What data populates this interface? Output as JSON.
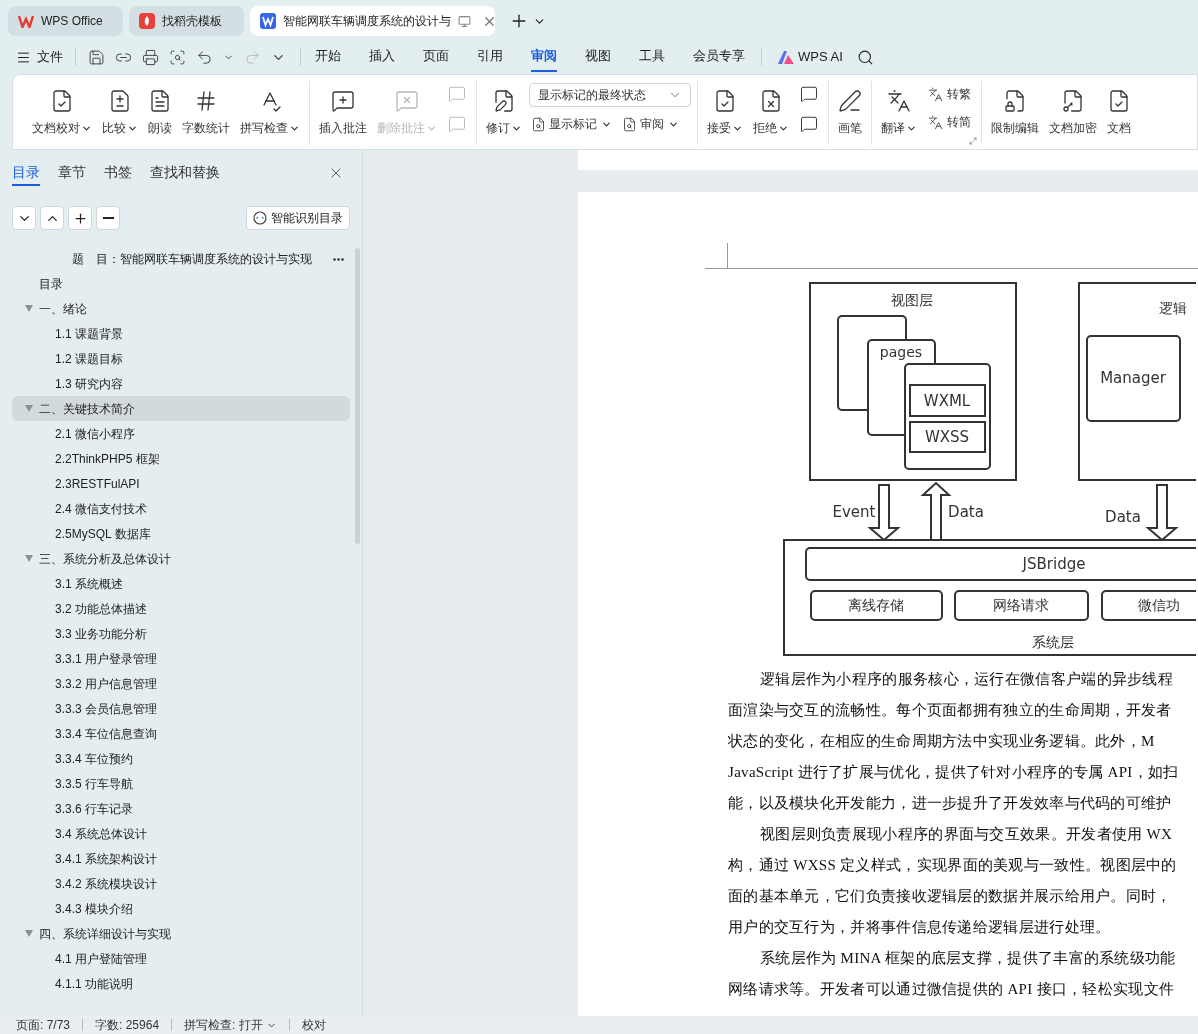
{
  "tabs": [
    {
      "label": "WPS Office",
      "selected": false,
      "kind": "home"
    },
    {
      "label": "找稻壳模板",
      "selected": false,
      "kind": "template"
    },
    {
      "label": "智能网联车辆调度系统的设计与",
      "selected": true,
      "kind": "doc"
    }
  ],
  "menu": {
    "file": "文件",
    "tabs": [
      {
        "label": "开始",
        "selected": false
      },
      {
        "label": "插入",
        "selected": false
      },
      {
        "label": "页面",
        "selected": false
      },
      {
        "label": "引用",
        "selected": false
      },
      {
        "label": "审阅",
        "selected": true
      },
      {
        "label": "视图",
        "selected": false
      },
      {
        "label": "工具",
        "selected": false
      },
      {
        "label": "会员专享",
        "selected": false
      }
    ],
    "ai": "WPS AI"
  },
  "ribbon": {
    "groups": [
      {
        "items": [
          {
            "kind": "large",
            "label": "文档校对",
            "caret": true,
            "disabled": false
          },
          {
            "kind": "large",
            "label": "比较",
            "caret": true,
            "disabled": false
          },
          {
            "kind": "large",
            "label": "朗读",
            "caret": false,
            "disabled": false
          },
          {
            "kind": "large",
            "label": "字数统计",
            "caret": false,
            "disabled": false
          },
          {
            "kind": "large",
            "label": "拼写检查",
            "caret": true,
            "disabled": false
          }
        ]
      },
      {
        "items": [
          {
            "kind": "large",
            "label": "插入批注",
            "caret": false,
            "disabled": false
          },
          {
            "kind": "large",
            "label": "删除批注",
            "caret": true,
            "disabled": true
          },
          {
            "kind": "icons",
            "disabled": true
          }
        ]
      },
      {
        "items": [
          {
            "kind": "large",
            "label": "修订",
            "caret": true,
            "disabled": false
          },
          {
            "kind": "panel",
            "select": "显示标记的最终状态",
            "buttons": [
              {
                "label": "显示标记",
                "caret": true
              },
              {
                "label": "审阅",
                "caret": true
              }
            ]
          }
        ]
      },
      {
        "items": [
          {
            "kind": "large",
            "label": "接受",
            "caret": true,
            "disabled": false
          },
          {
            "kind": "large",
            "label": "拒绝",
            "caret": true,
            "disabled": false
          },
          {
            "kind": "icons",
            "disabled": false
          }
        ]
      },
      {
        "items": [
          {
            "kind": "large",
            "label": "画笔",
            "caret": false,
            "disabled": false
          }
        ]
      },
      {
        "launcher": true,
        "items": [
          {
            "kind": "large",
            "label": "翻译",
            "caret": true,
            "disabled": false
          },
          {
            "kind": "pair",
            "buttons": [
              {
                "label": "转繁",
                "caret": false
              },
              {
                "label": "转简",
                "caret": false
              }
            ]
          }
        ]
      },
      {
        "items": [
          {
            "kind": "large",
            "label": "限制编辑",
            "caret": false,
            "disabled": false
          },
          {
            "kind": "large",
            "label": "文档加密",
            "caret": false,
            "disabled": false
          },
          {
            "kind": "large",
            "label": "文档",
            "caret": false,
            "disabled": false
          }
        ]
      }
    ]
  },
  "sidebar": {
    "tabs": [
      {
        "label": "目录",
        "selected": true
      },
      {
        "label": "章节",
        "selected": false
      },
      {
        "label": "书签",
        "selected": false
      },
      {
        "label": "查找和替换",
        "selected": false
      }
    ],
    "smart_button": "智能识别目录",
    "toc": [
      {
        "kind": "title",
        "label": "题　目：智能网联车辆调度系统的设计与实现",
        "selected": false
      },
      {
        "kind": "entry",
        "label": "目录",
        "selected": false
      },
      {
        "kind": "entry",
        "label": "一、绪论",
        "selected": false,
        "expanded": true,
        "children": [
          {
            "label": "1.1 课题背景",
            "selected": false
          },
          {
            "label": "1.2 课题目标",
            "selected": false
          },
          {
            "label": "1.3 研究内容",
            "selected": false
          }
        ]
      },
      {
        "kind": "entry",
        "label": "二、关键技术简介",
        "selected": true,
        "expanded": true,
        "children": [
          {
            "label": "2.1 微信小程序",
            "selected": false
          },
          {
            "label": "2.2ThinkPHP5 框架",
            "selected": false
          },
          {
            "label": "2.3RESTFulAPI",
            "selected": false
          },
          {
            "label": "2.4 微信支付技术",
            "selected": false
          },
          {
            "label": "2.5MySQL 数据库",
            "selected": false
          }
        ]
      },
      {
        "kind": "entry",
        "label": "三、系统分析及总体设计",
        "selected": false,
        "expanded": true,
        "children": [
          {
            "label": "3.1 系统概述",
            "selected": false
          },
          {
            "label": "3.2 功能总体描述",
            "selected": false
          },
          {
            "label": "3.3 业务功能分析",
            "selected": false
          },
          {
            "label": "3.3.1 用户登录管理",
            "selected": false
          },
          {
            "label": "3.3.2 用户信息管理",
            "selected": false
          },
          {
            "label": "3.3.3 会员信息管理",
            "selected": false
          },
          {
            "label": "3.3.4 车位信息查询",
            "selected": false
          },
          {
            "label": "3.3.4 车位预约",
            "selected": false
          },
          {
            "label": "3.3.5 行车导航",
            "selected": false
          },
          {
            "label": "3.3.6 行车记录",
            "selected": false
          },
          {
            "label": "3.4 系统总体设计",
            "selected": false
          },
          {
            "label": "3.4.1 系统架构设计",
            "selected": false
          },
          {
            "label": "3.4.2 系统模块设计",
            "selected": false
          },
          {
            "label": "3.4.3 模块介绍",
            "selected": false
          }
        ]
      },
      {
        "kind": "entry",
        "label": "四、系统详细设计与实现",
        "selected": false,
        "expanded": true,
        "children": [
          {
            "label": "4.1 用户登陆管理",
            "selected": false
          },
          {
            "label": "4.1.1 功能说明",
            "selected": false
          }
        ]
      }
    ]
  },
  "document": {
    "figure": {
      "view_layer": "视图层",
      "pages": "pages",
      "wxml": "WXML",
      "wxss": "WXSS",
      "logic_layer": "逻辑",
      "manager": "Manager",
      "event": "Event",
      "data_up": "Data",
      "data_down": "Data",
      "bridge": "JSBridge",
      "services": [
        "离线存储",
        "网络请求",
        "微信功"
      ],
      "system_layer": "系统层"
    },
    "paragraphs": [
      {
        "lines": [
          "逻辑层作为小程序的服务核心，运行在微信客户端的异步线程",
          "面渲染与交互的流畅性。每个页面都拥有独立的生命周期，开发者",
          "状态的变化，在相应的生命周期方法中实现业务逻辑。此外，M",
          "JavaScript 进行了扩展与优化，提供了针对小程序的专属 API，如扫",
          "能，以及模块化开发能力，进一步提升了开发效率与代码的可维护"
        ]
      },
      {
        "lines": [
          "视图层则负责展现小程序的界面与交互效果。开发者使用 WX",
          "构，通过 WXSS 定义样式，实现界面的美观与一致性。视图层中的",
          "面的基本单元，它们负责接收逻辑层的数据并展示给用户。同时，",
          "用户的交互行为，并将事件信息传递给逻辑层进行处理。"
        ]
      },
      {
        "lines": [
          "系统层作为 MINA 框架的底层支撑，提供了丰富的系统级功能",
          "网络请求等。开发者可以通过微信提供的 API 接口，轻松实现文件"
        ]
      }
    ]
  },
  "status_bar": {
    "page": "页面: 7/73",
    "words": "字数: 25964",
    "spell": "拼写检查: 打开",
    "proof": "校对"
  }
}
